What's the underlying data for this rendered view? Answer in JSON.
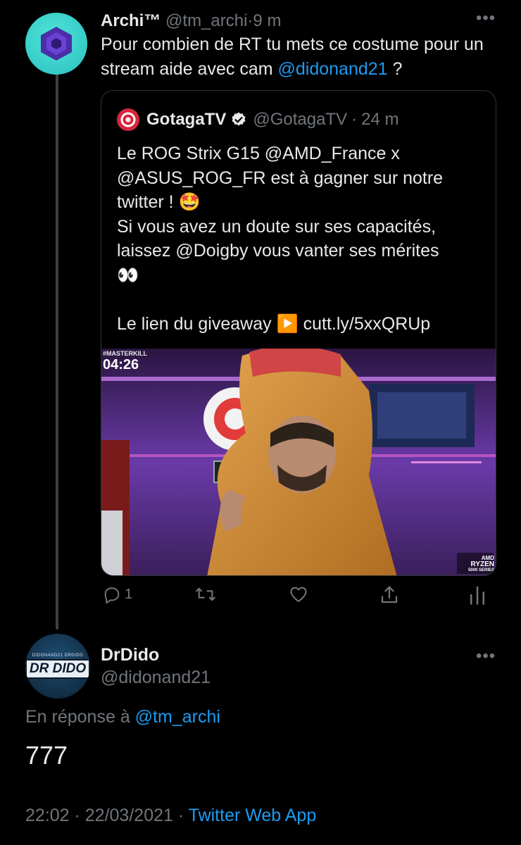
{
  "quoting_tweet": {
    "author_name": "Archi™",
    "author_handle": "@tm_archi",
    "separator": "·",
    "time": "9 m",
    "text_before": "Pour combien de RT tu mets ce costume pour un stream aide avec cam ",
    "text_mention": "@didonand21",
    "text_after": " ?",
    "more_label": "•••"
  },
  "quoted_tweet": {
    "author_name": "GotagaTV",
    "author_handle": "@GotagaTV",
    "separator": "·",
    "time": "24 m",
    "lines": [
      "Le ROG Strix G15 @AMD_France x",
      "@ASUS_ROG_FR est à gagner sur notre",
      "twitter ! 🤩",
      "Si vous avez un doute sur ses capacités,",
      "laissez @Doigby vous vanter ses mérites",
      "👀",
      "",
      "Le lien du giveaway ▶️ cutt.ly/5xxQRUp"
    ],
    "media": {
      "overlay_small": "#MASTERKILL",
      "overlay_timer": "04:26",
      "corner_brand_line1": "AMD",
      "corner_brand_line2": "RYZEN",
      "corner_brand_line3": "5000 SERIES"
    }
  },
  "actions": {
    "reply_count": "1",
    "icons": [
      "reply-icon",
      "retweet-icon",
      "like-icon",
      "share-icon",
      "analytics-icon"
    ]
  },
  "reply": {
    "author_name": "DrDido",
    "author_handle": "@didonand21",
    "avatar_text": "DR DIDO",
    "avatar_small_left": "DIDONAND21",
    "avatar_small_right": "DRDIDO",
    "replying_prefix": "En réponse à ",
    "replying_handle": "@tm_archi",
    "text": "777",
    "timestamp": "22:02 · 22/03/2021 · ",
    "source": "Twitter Web App",
    "more_label": "•••"
  },
  "colors": {
    "accent": "#1d9bf0",
    "muted": "#71767b",
    "background": "#000000"
  }
}
